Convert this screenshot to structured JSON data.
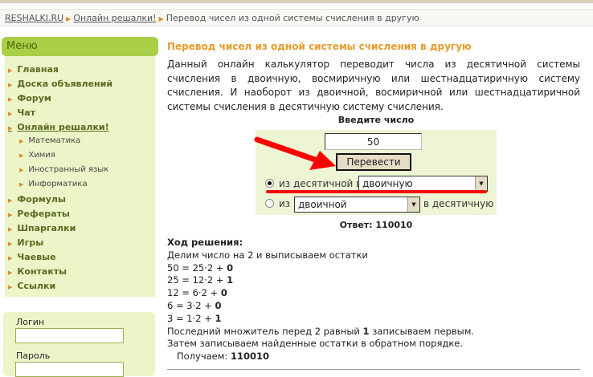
{
  "breadcrumb": [
    "RESHALKI.RU",
    "Онлайн решалки!",
    "Перевод чисел из одной системы счисления в другую"
  ],
  "menu": {
    "title": "Меню",
    "items": [
      {
        "label": "Главная",
        "sub": false
      },
      {
        "label": "Доска объявлений",
        "sub": false
      },
      {
        "label": "Форум",
        "sub": false
      },
      {
        "label": "Чат",
        "sub": false
      },
      {
        "label": "Онлайн решалки!",
        "sub": false
      },
      {
        "label": "Математика",
        "sub": true
      },
      {
        "label": "Химия",
        "sub": true
      },
      {
        "label": "Иностранный язык",
        "sub": true
      },
      {
        "label": "Информатика",
        "sub": true
      },
      {
        "label": "Формулы",
        "sub": false
      },
      {
        "label": "Рефераты",
        "sub": false
      },
      {
        "label": "Шпаргалки",
        "sub": false
      },
      {
        "label": "Игры",
        "sub": false
      },
      {
        "label": "Чаевые",
        "sub": false
      },
      {
        "label": "Контакты",
        "sub": false
      },
      {
        "label": "Ссылки",
        "sub": false
      }
    ]
  },
  "login": {
    "login_label": "Логин",
    "password_label": "Пароль"
  },
  "main": {
    "title": "Перевод чисел из одной системы счисления в другую",
    "description": "Данный онлайн калькулятор переводит числа из десятичной системы счисления в двоичную, восмиричную или шестнадцатиричную систему счисления. И наоборот из двоичной, восмиричной или шестнадцатиричной системы счисления в десятичную систему счисления.",
    "enter_label": "Введите число",
    "number_value": "50",
    "convert_button": "Перевести",
    "radio1_label": "из десятичной в",
    "select1_value": "двоичную",
    "radio2_prefix": "из",
    "select2_value": "двоичной",
    "radio2_suffix": "в десятичную",
    "answer": "Ответ: 110010"
  },
  "solution": {
    "heading": "Ход решения:",
    "intro": "Делим число на 2 и выписываем остатки",
    "steps": [
      {
        "expr": "50 = 25·2 + ",
        "rem": "0"
      },
      {
        "expr": "25 = 12·2 + ",
        "rem": "1"
      },
      {
        "expr": "12 = 6·2 + ",
        "rem": "0"
      },
      {
        "expr": "6 = 3·2 + ",
        "rem": "0"
      },
      {
        "expr": "3 = 1·2 + ",
        "rem": "1"
      }
    ],
    "last_a": "Последний множитель перед 2 равный ",
    "last_b": "1",
    "last_c": " записываем первым.",
    "reverse": "Затем записываем найденные остатки в обратном порядке.",
    "result_label": "Получаем: ",
    "result_value": "110010"
  },
  "colors": {
    "accent": "#e89c2a",
    "menu_green": "#a8cf45",
    "menu_bg": "#ebf5c8",
    "annotation": "#ff0000"
  }
}
